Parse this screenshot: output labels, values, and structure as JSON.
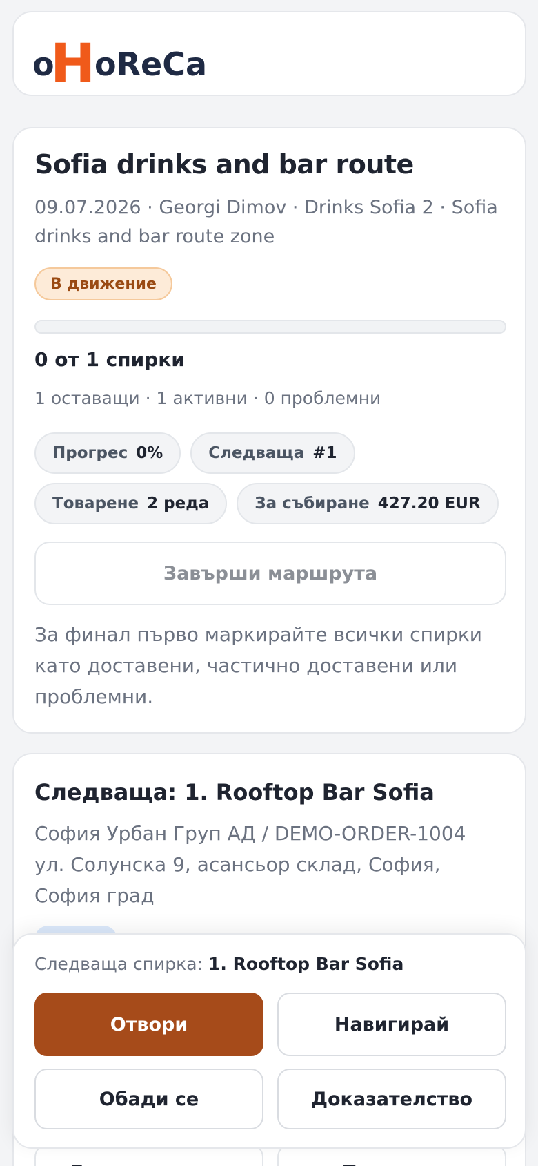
{
  "brand": {
    "logo_text_prefix": "o",
    "logo_text_h": "H",
    "logo_text_suffix": "oReCa",
    "accent_color": "#f05a1a",
    "ink_color": "#1f2a44"
  },
  "route": {
    "title": "Sofia drinks and bar route",
    "meta": "09.07.2026 · Georgi Dimov · Drinks Sofia 2 · Sofia drinks and bar route zone",
    "status": "В движение",
    "progress_fraction": 0,
    "stops_count": "0 от 1 спирки",
    "stops_summary": "1 оставащи · 1 активни · 0 проблемни",
    "chips": [
      {
        "label": "Прогрес",
        "value": "0%"
      },
      {
        "label": "Следваща",
        "value": "#1"
      },
      {
        "label": "Товарене",
        "value": "2 реда"
      },
      {
        "label": "За събиране",
        "value": "427.20 EUR"
      }
    ],
    "finish_button": "Завърши маршрута",
    "finish_hint": "За финал първо маркирайте всички спирки като доставени, частично доставени или проблемни."
  },
  "next_stop": {
    "title": "Следваща: 1. Rooftop Bar Sofia",
    "customer_order": "София Урбан Груп АД / DEMO-ORDER-1004",
    "address": "ул. Солунска 9, асансьор склад, София, София град",
    "under_buttons": [
      "Доказателство",
      "Плащане"
    ]
  },
  "bottom_bar": {
    "label_prefix": "Следваща спирка:",
    "label_stop": "1. Rooftop Bar Sofia",
    "buttons": {
      "open": "Отвори",
      "navigate": "Навигирай",
      "call": "Обади се",
      "proof": "Доказателство"
    }
  }
}
